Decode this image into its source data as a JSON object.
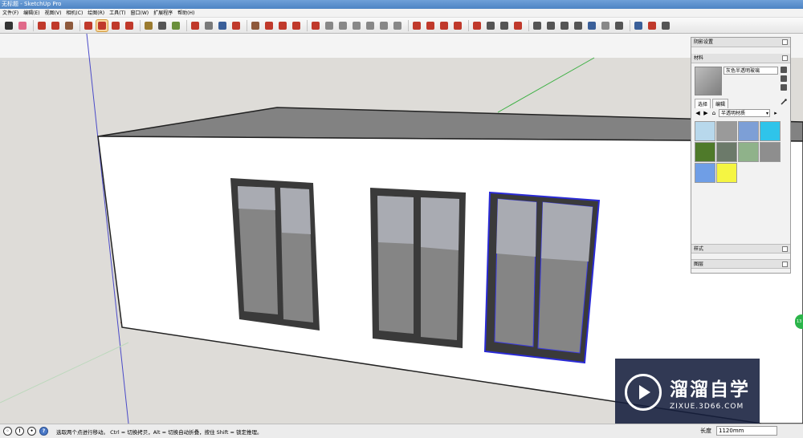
{
  "window": {
    "title": "无标题 - SketchUp Pro"
  },
  "menu": [
    "文件(F)",
    "编辑(E)",
    "视图(V)",
    "相机(C)",
    "绘图(R)",
    "工具(T)",
    "窗口(W)",
    "扩展程序",
    "帮助(H)"
  ],
  "toolbar": {
    "buttons": [
      {
        "name": "select-tool",
        "color": "#333333"
      },
      {
        "name": "eraser-tool",
        "color": "#e06a8a"
      },
      {
        "name": "line-tool",
        "color": "#c0392b"
      },
      {
        "name": "arc-tool",
        "color": "#c0392b"
      },
      {
        "name": "rectangle-tool",
        "color": "#8e5a3c"
      },
      {
        "name": "push-pull-tool",
        "color": "#c0392b"
      },
      {
        "name": "move-tool",
        "color": "#c0392b"
      },
      {
        "name": "rotate-tool",
        "color": "#c0392b"
      },
      {
        "name": "scale-tool",
        "color": "#c0392b"
      },
      {
        "name": "tape-measure-tool",
        "color": "#9b7b2f"
      },
      {
        "name": "text-tool",
        "color": "#555555"
      },
      {
        "name": "paint-bucket-tool",
        "color": "#6a8f3c"
      },
      {
        "name": "orbit-tool",
        "color": "#c0392b"
      },
      {
        "name": "pan-tool",
        "color": "#7a7a7a"
      },
      {
        "name": "zoom-tool",
        "color": "#3a5f99"
      },
      {
        "name": "zoom-extents-tool",
        "color": "#c0392b"
      },
      {
        "name": "warehouse-tool",
        "color": "#8e5a3c"
      },
      {
        "name": "components-tool",
        "color": "#c0392b"
      },
      {
        "name": "extension-tool",
        "color": "#c0392b"
      },
      {
        "name": "sandbox-tool",
        "color": "#c0392b"
      },
      {
        "name": "iso-view-tool",
        "color": "#c0392b"
      },
      {
        "name": "top-view-tool",
        "color": "#888888"
      },
      {
        "name": "front-view-tool",
        "color": "#888888"
      },
      {
        "name": "right-view-tool",
        "color": "#888888"
      },
      {
        "name": "back-view-tool",
        "color": "#888888"
      },
      {
        "name": "left-view-tool",
        "color": "#888888"
      },
      {
        "name": "xray-tool",
        "color": "#888888"
      },
      {
        "name": "follow-me-tool",
        "color": "#c0392b"
      },
      {
        "name": "offset-tool",
        "color": "#c0392b"
      },
      {
        "name": "intersect-tool",
        "color": "#c0392b"
      },
      {
        "name": "outer-shell-tool",
        "color": "#c0392b"
      },
      {
        "name": "section-plane-tool",
        "color": "#c0392b"
      },
      {
        "name": "dimension-tool",
        "color": "#555555"
      },
      {
        "name": "protractor-tool",
        "color": "#555555"
      },
      {
        "name": "axes-tool",
        "color": "#c0392b"
      },
      {
        "name": "walk-tool",
        "color": "#555555"
      },
      {
        "name": "position-camera-tool",
        "color": "#555555"
      },
      {
        "name": "look-around-tool",
        "color": "#555555"
      },
      {
        "name": "style-tool",
        "color": "#555555"
      },
      {
        "name": "shadow-tool",
        "color": "#3a5f99"
      },
      {
        "name": "fog-tool",
        "color": "#888888"
      },
      {
        "name": "solid-tools",
        "color": "#555555"
      },
      {
        "name": "plugin-tool-a",
        "color": "#3a5f99"
      },
      {
        "name": "plugin-tool-b",
        "color": "#c0392b"
      },
      {
        "name": "plugin-tool-c",
        "color": "#555555"
      }
    ]
  },
  "tray": {
    "shadow_title": "阴影设置",
    "materials_title": "材料",
    "material_name": "灰色半透明玻璃",
    "tab_select": "选择",
    "tab_edit": "编辑",
    "collection": "半透明材质",
    "swatches": [
      "#b8d8ec",
      "#9a9a9a",
      "#7d9fd6",
      "#2fc4ea",
      "#4f7a2a",
      "#6c7a6a",
      "#8fb28a",
      "#8e8e8e",
      "#6f9ee6",
      "#f5f542"
    ],
    "styles_title": "样式",
    "layers_title": "图层"
  },
  "edge_badge": "13",
  "watermark": {
    "title": "溜溜自学",
    "subtitle": "ZIXUE.3D66.COM"
  },
  "status": {
    "hint": "选取两个点进行移动。 Ctrl = 切换拷贝，Alt = 切换自动折叠，按住 Shift = 锁定推理。",
    "measure_label": "长度",
    "measure_value": "1120mm"
  }
}
